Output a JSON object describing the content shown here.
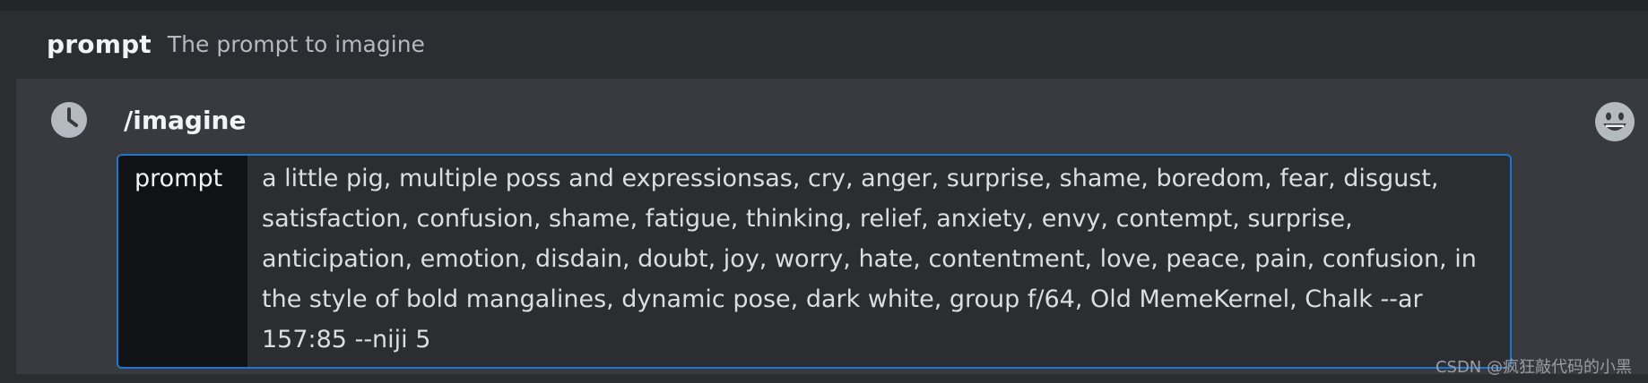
{
  "option_header": {
    "name": "prompt",
    "description": "The prompt to imagine"
  },
  "composer": {
    "command": "/imagine",
    "history_icon": "clock-icon",
    "emoji_icon": "smiley-face-icon"
  },
  "param": {
    "label": "prompt",
    "value": "a little pig, multiple poss and expressionsas, cry, anger, surprise, shame, boredom, fear, disgust, satisfaction, confusion, shame, fatigue, thinking, relief, anxiety, envy, contempt, surprise, anticipation, emotion, disdain, doubt, joy, worry, hate, contentment, love, peace, pain, confusion, in the style of bold mangalines, dynamic pose, dark white, group f/64, Old MemeKernel, Chalk --ar 157:85 --niji 5"
  },
  "watermark": "CSDN @疯狂敲代码的小黑",
  "colors": {
    "background": "#2b2d31",
    "composer": "#383a40",
    "accent_border": "#1a78d4",
    "label_bg": "#111214"
  }
}
